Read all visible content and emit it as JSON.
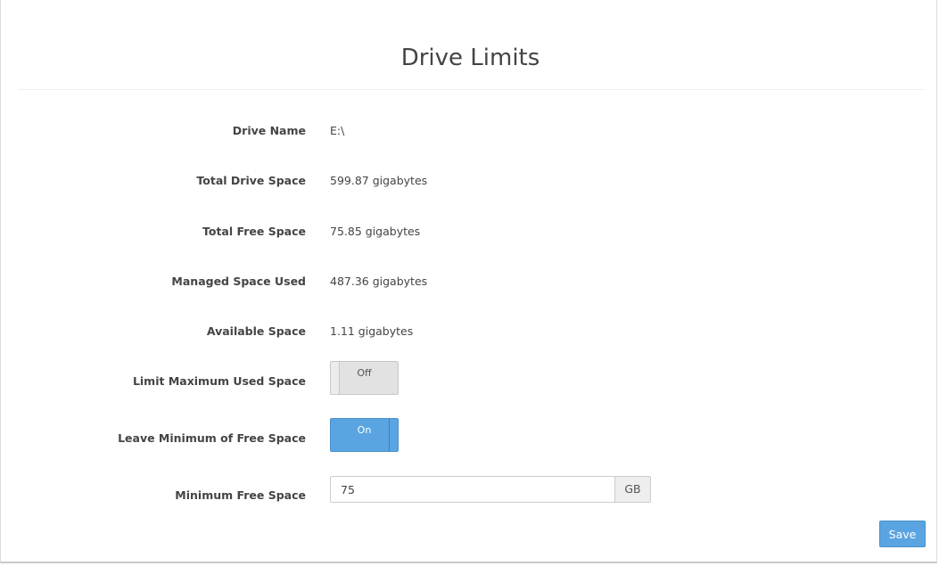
{
  "page": {
    "title": "Drive Limits"
  },
  "fields": {
    "drive_name": {
      "label": "Drive Name",
      "value": "E:\\"
    },
    "total_drive_space": {
      "label": "Total Drive Space",
      "value": "599.87 gigabytes"
    },
    "total_free_space": {
      "label": "Total Free Space",
      "value": "75.85 gigabytes"
    },
    "managed_space_used": {
      "label": "Managed Space Used",
      "value": "487.36 gigabytes"
    },
    "available_space": {
      "label": "Available Space",
      "value": "1.11 gigabytes"
    }
  },
  "toggles": {
    "limit_max_used": {
      "label": "Limit Maximum Used Space",
      "state_label": "Off",
      "state": "off"
    },
    "leave_min_free": {
      "label": "Leave Minimum of Free Space",
      "state_label": "On",
      "state": "on"
    }
  },
  "min_free_space": {
    "label": "Minimum Free Space",
    "value": "75",
    "unit": "GB"
  },
  "actions": {
    "save_label": "Save"
  },
  "colors": {
    "accent": "#5aa5e1",
    "toggle_off": "#e2e2e2"
  }
}
